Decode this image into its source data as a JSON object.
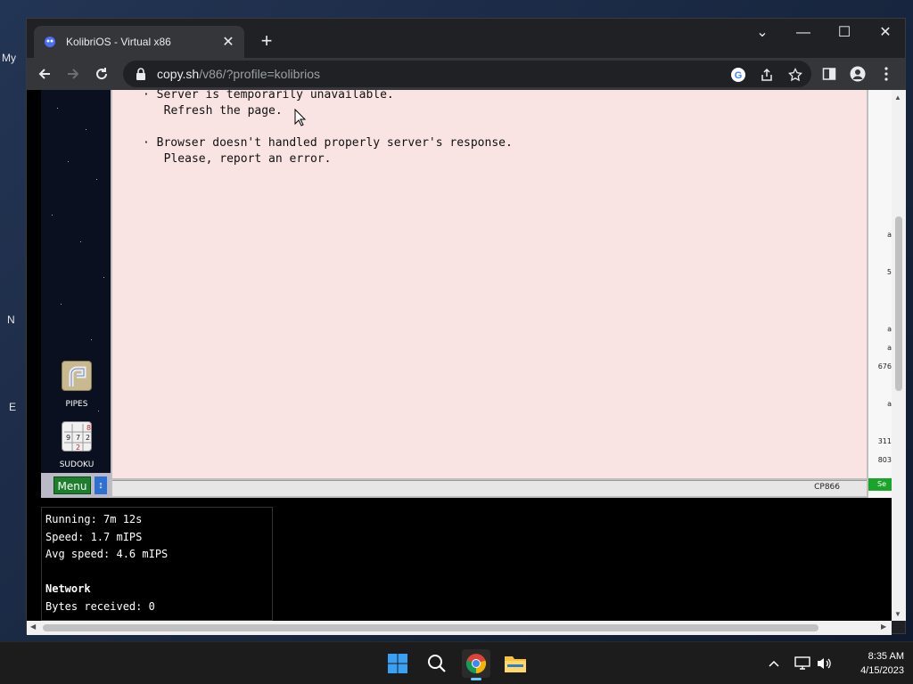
{
  "desktop": {
    "fragments": [
      "My",
      "N",
      "E"
    ]
  },
  "browser": {
    "tab": {
      "title": "KolibriOS - Virtual x86",
      "favicon": "kolibri-icon"
    },
    "new_tab_label": "+",
    "url_host": "copy.sh",
    "url_path": "/v86/?profile=kolibrios",
    "window_controls": [
      "tab-search-icon",
      "minimize-icon",
      "maximize-icon",
      "close-icon"
    ]
  },
  "kolibri": {
    "message_lines": [
      "· Server is temporarily unavailable.",
      "  Refresh the page.",
      "· Browser doesn't handled properly server's response.",
      "  Please, report an error."
    ],
    "desktop_icons": [
      {
        "label": "PIPES",
        "icon": "pipes-icon"
      },
      {
        "label": "SUDOKU",
        "icon": "sudoku-icon"
      }
    ],
    "menu_label": "Menu",
    "encoding": "CP866",
    "side_numbers": [
      "a",
      "5",
      "a",
      "a",
      "676",
      "a",
      "311",
      "803"
    ],
    "side_green": "Se"
  },
  "emulator_info": {
    "running": "Running: 7m 12s",
    "speed": "Speed: 1.7 mIPS",
    "avg_speed": "Avg speed: 4.6 mIPS",
    "network_header": "Network",
    "bytes_received": "Bytes received: 0"
  },
  "taskbar": {
    "time": "8:35 AM",
    "date": "4/15/2023",
    "apps": [
      "start-icon",
      "search-icon",
      "chrome-icon",
      "file-explorer-icon"
    ]
  }
}
